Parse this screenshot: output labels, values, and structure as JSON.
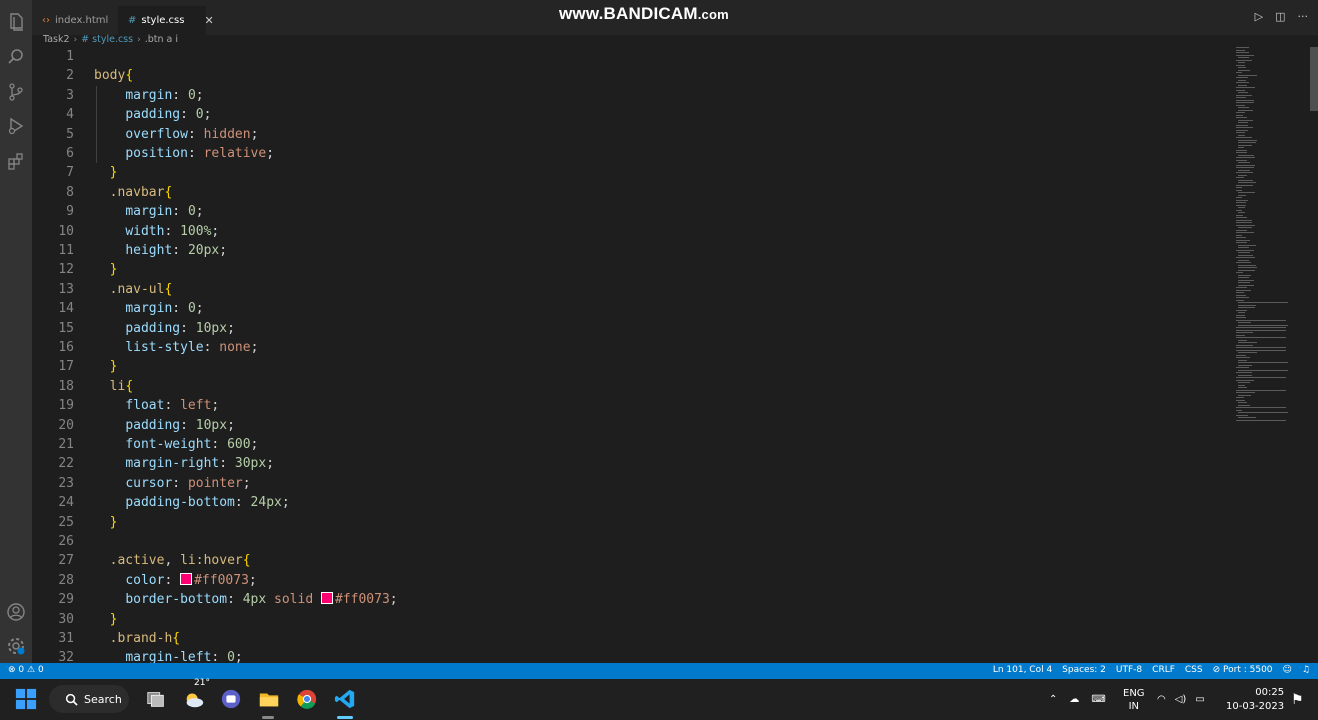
{
  "tabs": [
    {
      "icon": "html-icon",
      "label": "index.html"
    },
    {
      "icon": "css-hash-icon",
      "label": "style.css",
      "close": "✕"
    }
  ],
  "watermark": {
    "main": "www.BANDICAM",
    "suffix": ".com"
  },
  "breadcrumb": [
    "Task2",
    "# style.css",
    ".btn a i"
  ],
  "code": [
    [],
    [
      [
        "sel",
        "body"
      ],
      [
        "br",
        "{"
      ]
    ],
    [
      [
        "sp",
        "    "
      ],
      [
        "prop",
        "margin"
      ],
      [
        "pun",
        ": "
      ],
      [
        "num",
        "0"
      ],
      [
        "pun",
        ";"
      ]
    ],
    [
      [
        "sp",
        "    "
      ],
      [
        "prop",
        "padding"
      ],
      [
        "pun",
        ": "
      ],
      [
        "num",
        "0"
      ],
      [
        "pun",
        ";"
      ]
    ],
    [
      [
        "sp",
        "    "
      ],
      [
        "prop",
        "overflow"
      ],
      [
        "pun",
        ": "
      ],
      [
        "val",
        "hidden"
      ],
      [
        "pun",
        ";"
      ]
    ],
    [
      [
        "sp",
        "    "
      ],
      [
        "prop",
        "position"
      ],
      [
        "pun",
        ": "
      ],
      [
        "val",
        "relative"
      ],
      [
        "pun",
        ";"
      ]
    ],
    [
      [
        "sp",
        "  "
      ],
      [
        "br",
        "}"
      ]
    ],
    [
      [
        "sp",
        "  "
      ],
      [
        "sel",
        ".navbar"
      ],
      [
        "br",
        "{"
      ]
    ],
    [
      [
        "sp",
        "    "
      ],
      [
        "prop",
        "margin"
      ],
      [
        "pun",
        ": "
      ],
      [
        "num",
        "0"
      ],
      [
        "pun",
        ";"
      ]
    ],
    [
      [
        "sp",
        "    "
      ],
      [
        "prop",
        "width"
      ],
      [
        "pun",
        ": "
      ],
      [
        "num",
        "100%"
      ],
      [
        "pun",
        ";"
      ]
    ],
    [
      [
        "sp",
        "    "
      ],
      [
        "prop",
        "height"
      ],
      [
        "pun",
        ": "
      ],
      [
        "num",
        "20px"
      ],
      [
        "pun",
        ";"
      ]
    ],
    [
      [
        "sp",
        "  "
      ],
      [
        "br",
        "}"
      ]
    ],
    [
      [
        "sp",
        "  "
      ],
      [
        "sel",
        ".nav-ul"
      ],
      [
        "br",
        "{"
      ]
    ],
    [
      [
        "sp",
        "    "
      ],
      [
        "prop",
        "margin"
      ],
      [
        "pun",
        ": "
      ],
      [
        "num",
        "0"
      ],
      [
        "pun",
        ";"
      ]
    ],
    [
      [
        "sp",
        "    "
      ],
      [
        "prop",
        "padding"
      ],
      [
        "pun",
        ": "
      ],
      [
        "num",
        "10px"
      ],
      [
        "pun",
        ";"
      ]
    ],
    [
      [
        "sp",
        "    "
      ],
      [
        "prop",
        "list-style"
      ],
      [
        "pun",
        ": "
      ],
      [
        "val",
        "none"
      ],
      [
        "pun",
        ";"
      ]
    ],
    [
      [
        "sp",
        "  "
      ],
      [
        "br",
        "}"
      ]
    ],
    [
      [
        "sp",
        "  "
      ],
      [
        "sel",
        "li"
      ],
      [
        "br",
        "{"
      ]
    ],
    [
      [
        "sp",
        "    "
      ],
      [
        "prop",
        "float"
      ],
      [
        "pun",
        ": "
      ],
      [
        "val",
        "left"
      ],
      [
        "pun",
        ";"
      ]
    ],
    [
      [
        "sp",
        "    "
      ],
      [
        "prop",
        "padding"
      ],
      [
        "pun",
        ": "
      ],
      [
        "num",
        "10px"
      ],
      [
        "pun",
        ";"
      ]
    ],
    [
      [
        "sp",
        "    "
      ],
      [
        "prop",
        "font-weight"
      ],
      [
        "pun",
        ": "
      ],
      [
        "num",
        "600"
      ],
      [
        "pun",
        ";"
      ]
    ],
    [
      [
        "sp",
        "    "
      ],
      [
        "prop",
        "margin-right"
      ],
      [
        "pun",
        ": "
      ],
      [
        "num",
        "30px"
      ],
      [
        "pun",
        ";"
      ]
    ],
    [
      [
        "sp",
        "    "
      ],
      [
        "prop",
        "cursor"
      ],
      [
        "pun",
        ": "
      ],
      [
        "val",
        "pointer"
      ],
      [
        "pun",
        ";"
      ]
    ],
    [
      [
        "sp",
        "    "
      ],
      [
        "prop",
        "padding-bottom"
      ],
      [
        "pun",
        ": "
      ],
      [
        "num",
        "24px"
      ],
      [
        "pun",
        ";"
      ]
    ],
    [
      [
        "sp",
        "  "
      ],
      [
        "br",
        "}"
      ]
    ],
    [],
    [
      [
        "sp",
        "  "
      ],
      [
        "sel",
        ".active"
      ],
      [
        "pun",
        ", "
      ],
      [
        "sel",
        "li:hover"
      ],
      [
        "br",
        "{"
      ]
    ],
    [
      [
        "sp",
        "    "
      ],
      [
        "prop",
        "color"
      ],
      [
        "pun",
        ": "
      ],
      [
        "swatch",
        "#ff0073"
      ],
      [
        "val",
        "#ff0073"
      ],
      [
        "pun",
        ";"
      ]
    ],
    [
      [
        "sp",
        "    "
      ],
      [
        "prop",
        "border-bottom"
      ],
      [
        "pun",
        ": "
      ],
      [
        "num",
        "4px"
      ],
      [
        "pun",
        " "
      ],
      [
        "val",
        "solid"
      ],
      [
        "pun",
        " "
      ],
      [
        "swatch",
        "#ff0073"
      ],
      [
        "val",
        "#ff0073"
      ],
      [
        "pun",
        ";"
      ]
    ],
    [
      [
        "sp",
        "  "
      ],
      [
        "br",
        "}"
      ]
    ],
    [
      [
        "sp",
        "  "
      ],
      [
        "sel",
        ".brand-h"
      ],
      [
        "br",
        "{"
      ]
    ],
    [
      [
        "sp",
        "    "
      ],
      [
        "prop",
        "margin-left"
      ],
      [
        "pun",
        ": "
      ],
      [
        "num",
        "0"
      ],
      [
        "pun",
        ";"
      ]
    ]
  ],
  "status": {
    "errors": "0",
    "warnings": "0",
    "right": [
      "Ln 101, Col 4",
      "Spaces: 2",
      "UTF-8",
      "CRLF",
      "CSS",
      "Port : 5500"
    ]
  },
  "taskbar": {
    "search_label": "Search",
    "weather_temp": "21°",
    "lang_top": "ENG",
    "lang_bottom": "IN",
    "time": "00:25",
    "date": "10-03-2023"
  },
  "colors": {
    "accent": "#007acc",
    "swatch": "#ff0073"
  }
}
